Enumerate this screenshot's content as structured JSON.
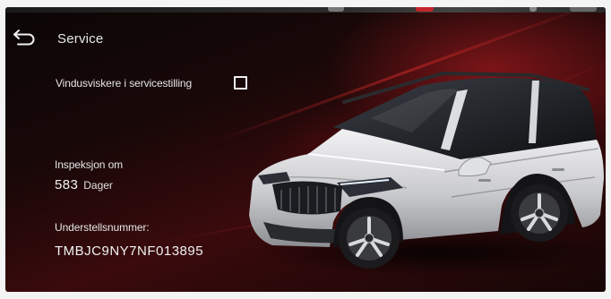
{
  "header": {
    "title": "Service",
    "back_icon": "back-arrow-icon"
  },
  "settings": {
    "wipers_label": "Vindusviskere i servicestilling",
    "wipers_checked": false
  },
  "inspection": {
    "label": "Inspeksjon om",
    "value": "583",
    "unit": "Dager"
  },
  "vehicle": {
    "vin_label": "Understellsnummer:",
    "vin": "TMBJC9NY7NF013895",
    "image": "car-image"
  },
  "colors": {
    "accent_red": "#c3242a",
    "text": "#e8e8e8",
    "background": "#120606"
  }
}
